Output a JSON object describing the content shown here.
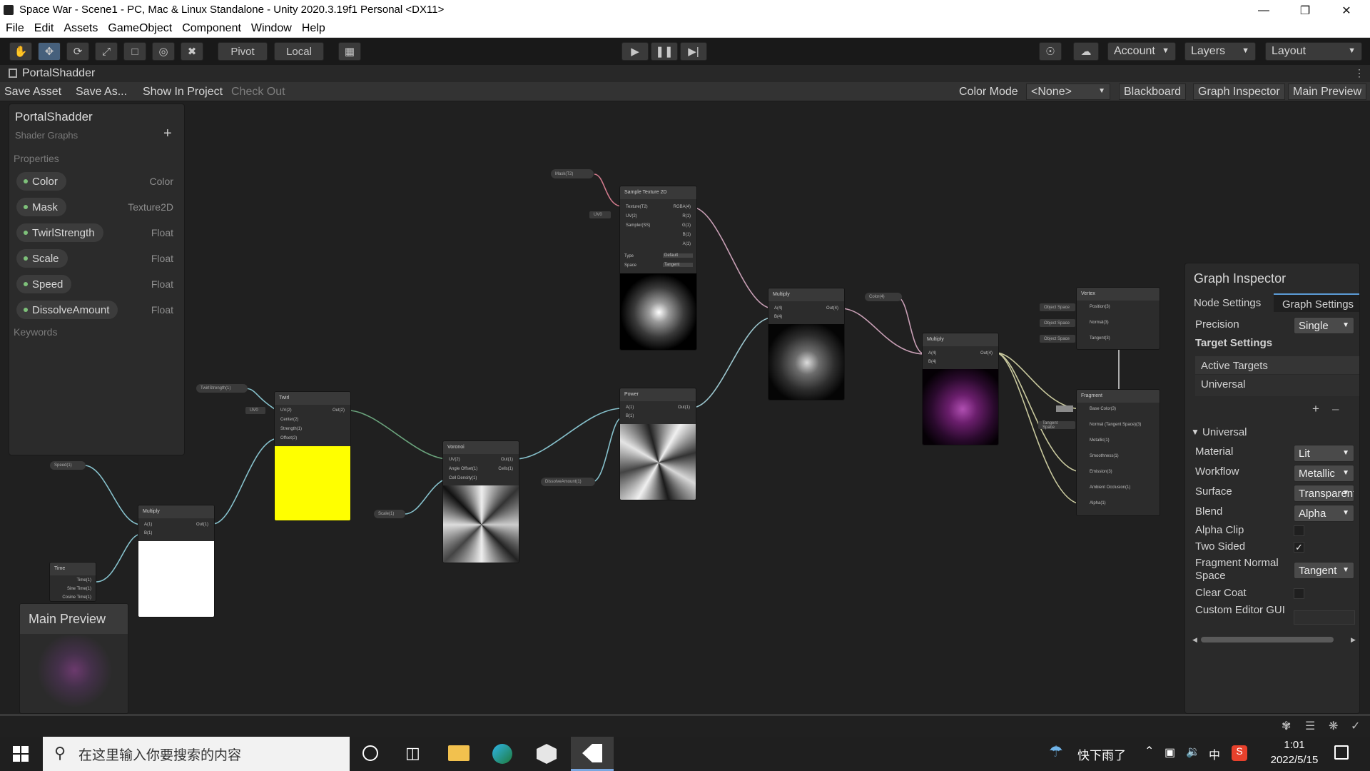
{
  "window": {
    "title": "Space War - Scene1 - PC, Mac & Linux Standalone - Unity 2020.3.19f1 Personal <DX11>"
  },
  "menu": [
    "File",
    "Edit",
    "Assets",
    "GameObject",
    "Component",
    "Window",
    "Help"
  ],
  "toolbar": {
    "pivot": "Pivot",
    "local": "Local",
    "account": "Account",
    "layers": "Layers",
    "layout": "Layout"
  },
  "tab": {
    "title": "PortalShadder"
  },
  "asset_toolbar": {
    "save_asset": "Save Asset",
    "save_as": "Save As...",
    "show_in_project": "Show In Project",
    "check_out": "Check Out",
    "color_mode_label": "Color Mode",
    "color_mode_value": "<None>",
    "blackboard": "Blackboard",
    "graph_inspector": "Graph Inspector",
    "main_preview": "Main Preview"
  },
  "blackboard": {
    "title": "PortalShadder",
    "subtitle": "Shader Graphs",
    "properties_header": "Properties",
    "keywords_header": "Keywords",
    "properties": [
      {
        "name": "Color",
        "type": "Color"
      },
      {
        "name": "Mask",
        "type": "Texture2D"
      },
      {
        "name": "TwirlStrength",
        "type": "Float"
      },
      {
        "name": "Scale",
        "type": "Float"
      },
      {
        "name": "Speed",
        "type": "Float"
      },
      {
        "name": "DissolveAmount",
        "type": "Float"
      }
    ]
  },
  "nodes": {
    "sample_texture": {
      "title": "Sample Texture 2D",
      "inputs": [
        "Texture(T2)",
        "UV(2)",
        "Sampler(SS)"
      ],
      "outputs": [
        "RGBA(4)",
        "R(1)",
        "G(1)",
        "B(1)",
        "A(1)"
      ],
      "type_label": "Type",
      "type_value": "Default",
      "space_label": "Space",
      "space_value": "Tangent"
    },
    "mask_prop": "Mask(T2)",
    "uv0_a": "UV0",
    "multiply_a": {
      "title": "Multiply",
      "inputs": [
        "A(4)",
        "B(4)"
      ],
      "output": "Out(4)"
    },
    "color_prop": "Color(4)",
    "multiply_b": {
      "title": "Multiply",
      "inputs": [
        "A(4)",
        "B(4)"
      ],
      "output": "Out(4)"
    },
    "twirl": {
      "title": "Twirl",
      "inputs": [
        "UV(2)",
        "Center(2)",
        "Strength(1)",
        "Offset(2)"
      ],
      "output": "Out(2)"
    },
    "twirlstrength_prop": "TwirlStrength(1)",
    "uv0_b": "UV0",
    "voronoi": {
      "title": "Voronoi",
      "inputs": [
        "UV(2)",
        "Angle Offset(1)",
        "Cell Density(1)"
      ],
      "outputs": [
        "Out(1)",
        "Cells(1)"
      ]
    },
    "scale_prop": "Scale(1)",
    "power": {
      "title": "Power",
      "inputs": [
        "A(1)",
        "B(1)"
      ],
      "output": "Out(1)"
    },
    "dissolve_prop": "DissolveAmount(1)",
    "speed_prop": "Speed(1)",
    "multiply_c": {
      "title": "Multiply",
      "inputs": [
        "A(1)",
        "B(1)"
      ],
      "output": "Out(1)"
    },
    "time": {
      "title": "Time",
      "outputs": [
        "Time(1)",
        "Sine Time(1)",
        "Cosine Time(1)"
      ]
    },
    "vertex": {
      "title": "Vertex",
      "ports": [
        "Position(3)",
        "Normal(3)",
        "Tangent(3)"
      ],
      "spaces": [
        "Object Space",
        "Object Space",
        "Object Space"
      ]
    },
    "fragment": {
      "title": "Fragment",
      "ports": [
        "Base Color(3)",
        "Normal (Tangent Space)(3)",
        "Metallic(1)",
        "Smoothness(1)",
        "Emission(3)",
        "Ambient Occlusion(1)",
        "Alpha(1)"
      ],
      "tangent_space": "Tangent Space"
    }
  },
  "inspector": {
    "title": "Graph Inspector",
    "tabs": [
      "Node Settings",
      "Graph Settings"
    ],
    "precision_label": "Precision",
    "precision_value": "Single",
    "target_settings": "Target Settings",
    "active_targets": "Active Targets",
    "active_target_item": "Universal",
    "universal_header": "Universal",
    "material_label": "Material",
    "material_value": "Lit",
    "workflow_label": "Workflow",
    "workflow_value": "Metallic",
    "surface_label": "Surface",
    "surface_value": "Transparent",
    "blend_label": "Blend",
    "blend_value": "Alpha",
    "alpha_clip_label": "Alpha Clip",
    "two_sided_label": "Two Sided",
    "fragment_normal_label": "Fragment Normal Space",
    "fragment_normal_value": "Tangent",
    "clear_coat_label": "Clear Coat",
    "custom_editor_label": "Custom Editor GUI"
  },
  "main_preview": {
    "title": "Main Preview"
  },
  "taskbar": {
    "search_placeholder": "在这里输入你要搜索的内容",
    "weather": "快下雨了",
    "ime": "中",
    "time": "1:01",
    "date": "2022/5/15"
  }
}
